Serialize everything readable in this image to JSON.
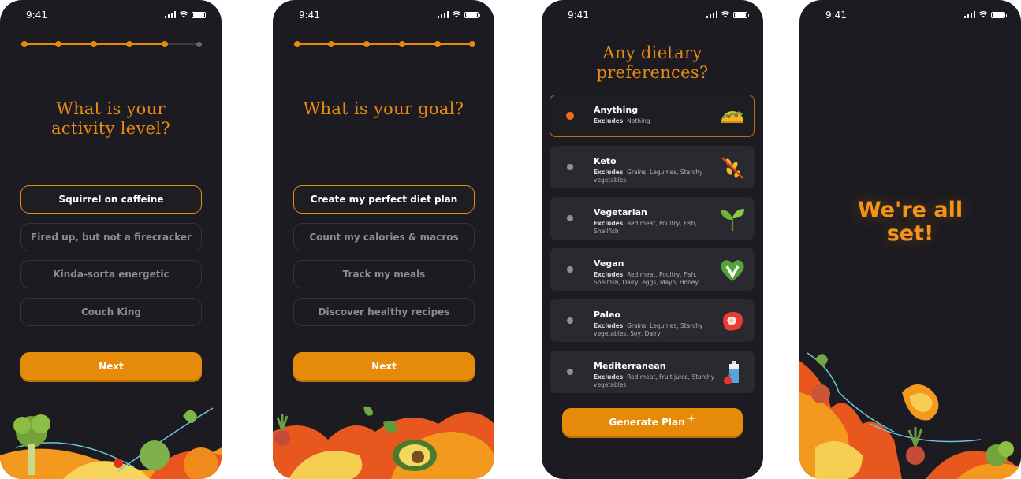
{
  "status": {
    "time": "9:41"
  },
  "screen1": {
    "title": "What is your activity level?",
    "progress": {
      "steps": 6,
      "completed": 5
    },
    "options": [
      "Squirrel on caffeine",
      "Fired up, but not a firecracker",
      "Kinda-sorta energetic",
      "Couch King"
    ],
    "selected_index": 0,
    "next_label": "Next"
  },
  "screen2": {
    "title": "What is your goal?",
    "progress": {
      "steps": 6,
      "completed": 6
    },
    "options": [
      "Create my perfect diet plan",
      "Count my calories & macros",
      "Track my meals",
      "Discover healthy recipes"
    ],
    "selected_index": 0,
    "next_label": "Next"
  },
  "screen3": {
    "title": "Any dietary preferences?",
    "excludes_label": "Excludes",
    "diets": [
      {
        "name": "Anything",
        "excludes": "Nothing",
        "icon": "taco-icon"
      },
      {
        "name": "Keto",
        "excludes": "Grains, Legumes, Starchy vegetables",
        "icon": "no-grain-icon"
      },
      {
        "name": "Vegetarian",
        "excludes": "Red meat, Poultry, Fish, Shellfish",
        "icon": "sprout-icon"
      },
      {
        "name": "Vegan",
        "excludes": "Red meat, Poultry, Fish, Shellfish, Dairy, eggs, Mayo, Honey",
        "icon": "vegan-heart-icon"
      },
      {
        "name": "Paleo",
        "excludes": "Grains, Legumes, Starchy vegetables, Soy, Dairy",
        "icon": "steak-icon"
      },
      {
        "name": "Mediterranean",
        "excludes": "Red meat, Fruit juice, Starchy vegetables",
        "icon": "juice-box-icon"
      }
    ],
    "selected_index": 0,
    "generate_label": "Generate Plan"
  },
  "screen4": {
    "message_line1": "We're all",
    "message_line2": "set!"
  },
  "colors": {
    "background": "#1c1b21",
    "accent": "#e68a0a",
    "title": "#e88b13",
    "radio_selected": "#f26a1b"
  }
}
